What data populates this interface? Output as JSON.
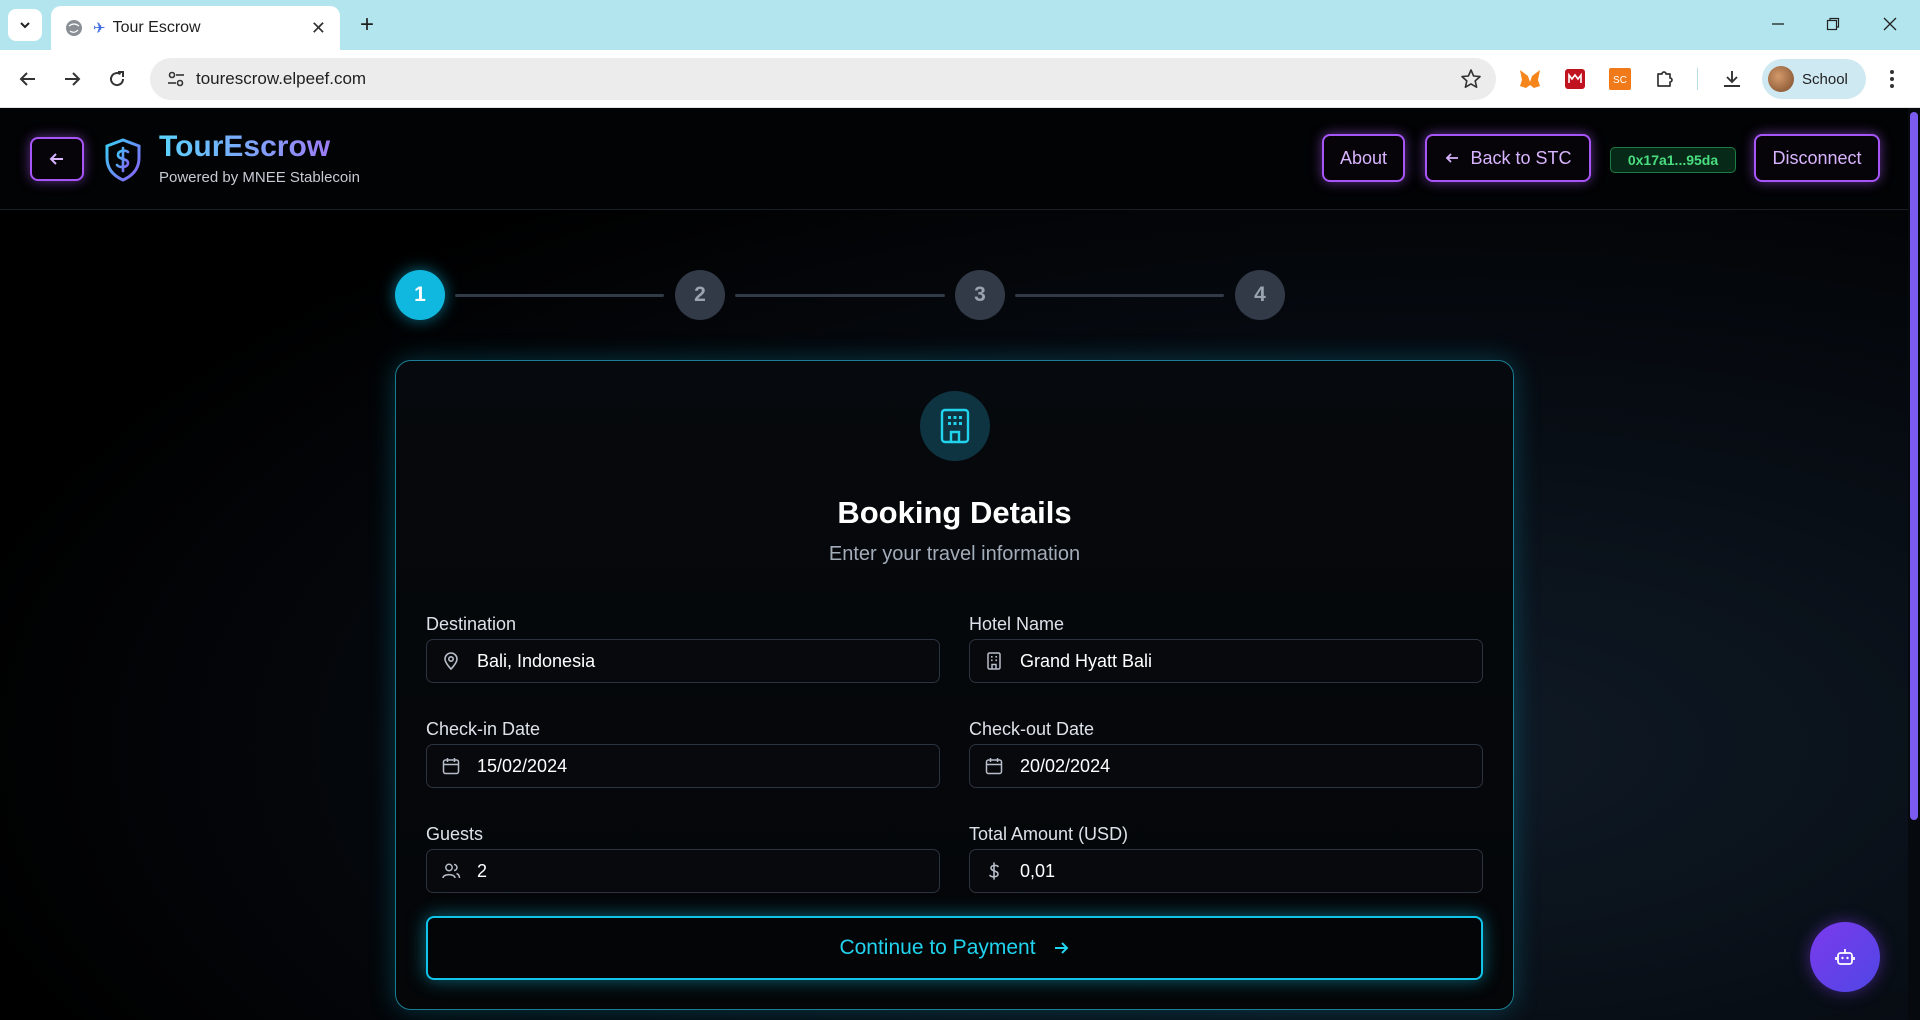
{
  "browser": {
    "tab_title": "Tour Escrow",
    "url": "tourescrow.elpeef.com",
    "profile_name": "School",
    "ext_sc_label": "SC"
  },
  "header": {
    "brand_title": "TourEscrow",
    "brand_subtitle": "Powered by MNEE Stablecoin",
    "about_label": "About",
    "back_stc_label": "Back to STC",
    "wallet_address": "0x17a1...95da",
    "disconnect_label": "Disconnect"
  },
  "stepper": {
    "steps": [
      "1",
      "2",
      "3",
      "4"
    ],
    "active_step": 1
  },
  "card": {
    "title": "Booking Details",
    "subtitle": "Enter your travel information",
    "fields": {
      "destination": {
        "label": "Destination",
        "value": "Bali, Indonesia"
      },
      "hotel": {
        "label": "Hotel Name",
        "value": "Grand Hyatt Bali"
      },
      "checkin": {
        "label": "Check-in Date",
        "value": "15/02/2024"
      },
      "checkout": {
        "label": "Check-out Date",
        "value": "20/02/2024"
      },
      "guests": {
        "label": "Guests",
        "value": "2"
      },
      "amount": {
        "label": "Total Amount (USD)",
        "value": "0,01"
      }
    },
    "continue_label": "Continue to Payment"
  },
  "colors": {
    "accent_cyan": "#10b8e0",
    "accent_purple": "#a855f7",
    "wallet_green": "#4ade80"
  }
}
